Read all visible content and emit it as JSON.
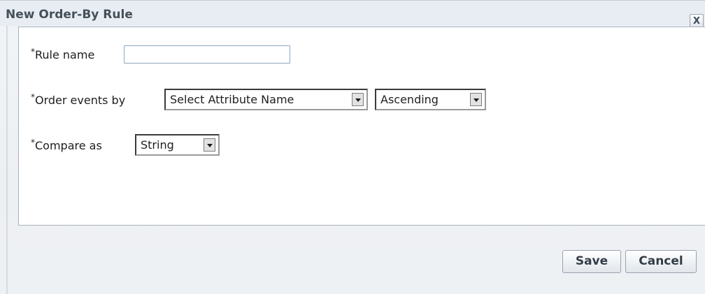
{
  "dialog": {
    "title": "New Order-By Rule",
    "close_label": "X"
  },
  "form": {
    "required_marker": "*",
    "rule_name": {
      "label": "Rule name",
      "value": ""
    },
    "order_events_by": {
      "label": "Order events by",
      "attribute_select": "Select Attribute Name",
      "direction_select": "Ascending"
    },
    "compare_as": {
      "label": "Compare as",
      "value": "String"
    }
  },
  "buttons": {
    "save": "Save",
    "cancel": "Cancel"
  }
}
